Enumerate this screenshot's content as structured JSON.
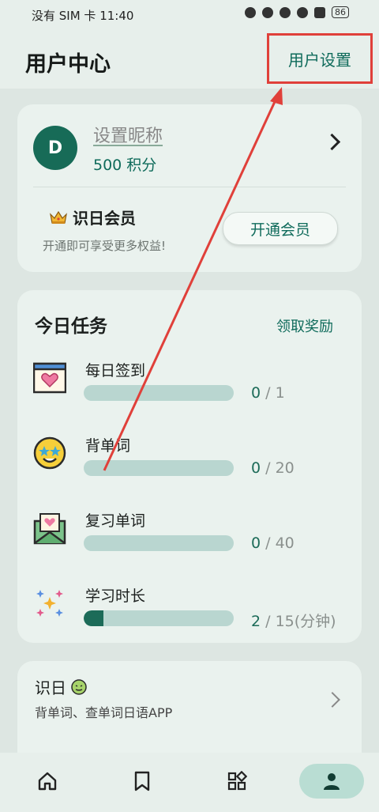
{
  "status_bar": {
    "left_text": "没有 SIM 卡",
    "time": "11:40",
    "battery": "86"
  },
  "header": {
    "title": "用户中心",
    "settings_label": "用户设置"
  },
  "profile": {
    "avatar_letter": "D",
    "nickname": "设置昵称",
    "points": "500 积分",
    "vip_title": "识日会员",
    "vip_subtitle": "开通即可享受更多权益!",
    "vip_button": "开通会员"
  },
  "tasks": {
    "title": "今日任务",
    "claim_label": "领取奖励",
    "items": [
      {
        "name": "每日签到",
        "done": "0",
        "total": " / 1",
        "progress": 0
      },
      {
        "name": "背单词",
        "done": "0",
        "total": " / 20",
        "progress": 0
      },
      {
        "name": "复习单词",
        "done": "0",
        "total": " / 40",
        "progress": 0
      },
      {
        "name": "学习时长",
        "done": "2",
        "total": " / 15(分钟)",
        "progress": 0.1333
      }
    ]
  },
  "app_card": {
    "name": "识日",
    "description": "背单词、查单词日语APP"
  },
  "nav": [
    {
      "icon": "home-icon"
    },
    {
      "icon": "bookmark-icon"
    },
    {
      "icon": "apps-icon"
    },
    {
      "icon": "person-icon",
      "active": true
    }
  ],
  "colors": {
    "accent": "#0f6b5b",
    "annotation_red": "#e0403a"
  }
}
